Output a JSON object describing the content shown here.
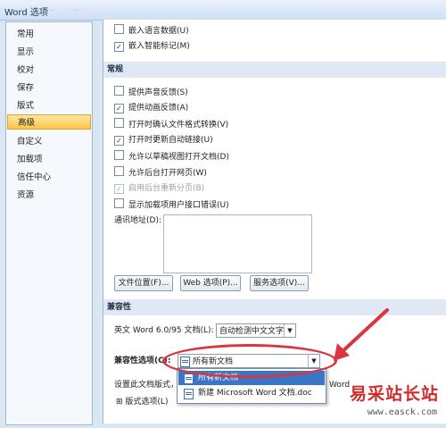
{
  "window": {
    "title": "Word 选项",
    "ghost_tabs": [
      "...",
      "..."
    ]
  },
  "sidebar": {
    "items": [
      {
        "label": "常用",
        "selected": false
      },
      {
        "label": "显示",
        "selected": false
      },
      {
        "label": "校对",
        "selected": false
      },
      {
        "label": "保存",
        "selected": false
      },
      {
        "label": "版式",
        "selected": false
      },
      {
        "label": "高级",
        "selected": true
      },
      {
        "label": "自定义",
        "selected": false
      },
      {
        "label": "加载项",
        "selected": false
      },
      {
        "label": "信任中心",
        "selected": false
      },
      {
        "label": "资源",
        "selected": false
      }
    ]
  },
  "top_options": [
    {
      "label": "嵌入语言数据(U)",
      "checked": false
    },
    {
      "label": "嵌入智能标记(M)",
      "checked": true
    }
  ],
  "general": {
    "heading": "常规",
    "options": [
      {
        "label": "提供声音反馈(S)",
        "checked": false,
        "disabled": false
      },
      {
        "label": "提供动画反馈(A)",
        "checked": true,
        "disabled": false
      },
      {
        "label": "打开时确认文件格式转换(V)",
        "checked": false,
        "disabled": false
      },
      {
        "label": "打开时更新自动链接(U)",
        "checked": true,
        "disabled": false
      },
      {
        "label": "允许以草稿视图打开文档(D)",
        "checked": false,
        "disabled": false
      },
      {
        "label": "允许后台打开网页(W)",
        "checked": false,
        "disabled": false
      },
      {
        "label": "启用后台重新分页(B)",
        "checked": true,
        "disabled": true
      },
      {
        "label": "显示加载项用户接口错误(U)",
        "checked": false,
        "disabled": false
      }
    ],
    "mailing_address_label": "通讯地址(D):",
    "buttons": {
      "file_locations": "文件位置(F)...",
      "web_options": "Web 选项(P)...",
      "service_options": "服务选项(V)..."
    }
  },
  "compatibility": {
    "heading": "兼容性",
    "english_word_label": "英文 Word 6.0/95 文档(L):",
    "english_word_value": "自动检测中文文字",
    "options_for_label": "兼容性选项(C):",
    "options_for_value": "所有新文档",
    "layout_as_label": "设置此文档版式，",
    "layout_as_tail": "Word",
    "layout_options_label": "版式选项(L)",
    "expand_glyph": "⊞"
  },
  "dropdown": {
    "items": [
      {
        "label": "所有新文档",
        "highlighted": true
      },
      {
        "label": "新建 Microsoft Word 文档.doc",
        "highlighted": false
      }
    ]
  },
  "watermark": {
    "text": "易采站长站",
    "url": "www.easck.com"
  },
  "colors": {
    "annotation": "#d9363e",
    "selected_nav": "#ffc34a",
    "highlight": "#3a76c8"
  }
}
